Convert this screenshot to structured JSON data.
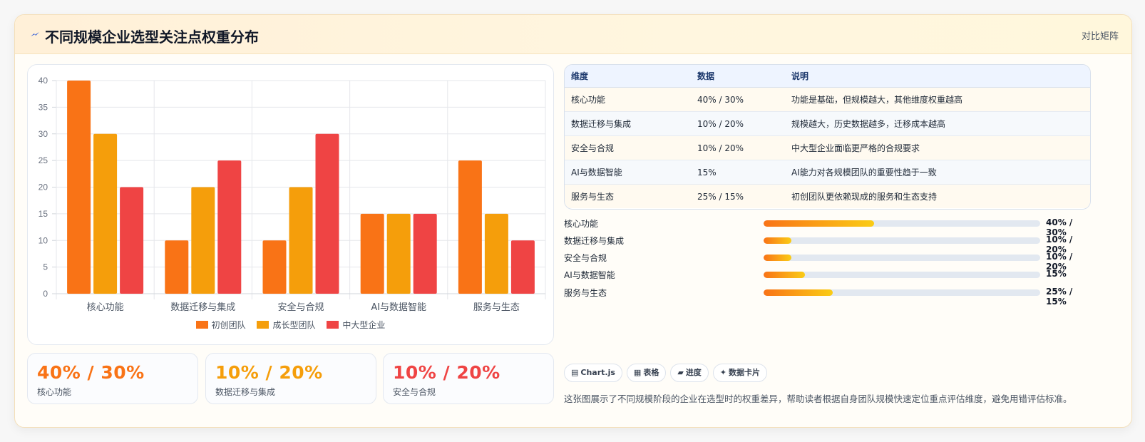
{
  "header": {
    "icon": "lightning-icon",
    "title": "不同规模企业选型关注点权重分布",
    "right_label": "对比矩阵"
  },
  "colors": {
    "series": [
      "#f97316",
      "#f59e0b",
      "#ef4444"
    ],
    "accent": "#f97316"
  },
  "chart_data": {
    "type": "bar",
    "categories": [
      "核心功能",
      "数据迁移与集成",
      "安全与合规",
      "AI与数据智能",
      "服务与生态"
    ],
    "series": [
      {
        "name": "初创团队",
        "values": [
          40,
          10,
          10,
          15,
          25
        ]
      },
      {
        "name": "成长型团队",
        "values": [
          30,
          20,
          20,
          15,
          15
        ]
      },
      {
        "name": "中大型企业",
        "values": [
          20,
          25,
          30,
          15,
          10
        ]
      }
    ],
    "yticks": [
      "0",
      "5",
      "10",
      "15",
      "20",
      "25",
      "30",
      "35",
      "40"
    ],
    "ylim": [
      0,
      40
    ],
    "grid": true,
    "legend_position": "bottom"
  },
  "stats": [
    {
      "value": "40% / 30%",
      "label": "核心功能",
      "color": "#f97316"
    },
    {
      "value": "10% / 20%",
      "label": "数据迁移与集成",
      "color": "#f59e0b"
    },
    {
      "value": "10% / 20%",
      "label": "安全与合规",
      "color": "#ef4444"
    }
  ],
  "table": {
    "headers": [
      "维度",
      "数据",
      "说明"
    ],
    "rows": [
      [
        "核心功能",
        "40% / 30%",
        "功能是基础，但规模越大，其他维度权重越高"
      ],
      [
        "数据迁移与集成",
        "10% / 20%",
        "规模越大，历史数据越多，迁移成本越高"
      ],
      [
        "安全与合规",
        "10% / 20%",
        "中大型企业面临更严格的合规要求"
      ],
      [
        "AI与数据智能",
        "15%",
        "AI能力对各规模团队的重要性趋于一致"
      ],
      [
        "服务与生态",
        "25% / 15%",
        "初创团队更依赖现成的服务和生态支持"
      ]
    ]
  },
  "progress": [
    {
      "label": "核心功能",
      "value": "40% / 30%",
      "fraction": 0.4
    },
    {
      "label": "数据迁移与集成",
      "value": "10% / 20%",
      "fraction": 0.1
    },
    {
      "label": "安全与合规",
      "value": "10% / 20%",
      "fraction": 0.1
    },
    {
      "label": "AI与数据智能",
      "value": "15%",
      "fraction": 0.15
    },
    {
      "label": "服务与生态",
      "value": "25% / 15%",
      "fraction": 0.25
    }
  ],
  "chips": [
    {
      "icon": "chart-icon",
      "glyph": "▤",
      "label": "Chart.js"
    },
    {
      "icon": "table-icon",
      "glyph": "▦",
      "label": "表格"
    },
    {
      "icon": "progress-icon",
      "glyph": "▰",
      "label": "进度"
    },
    {
      "icon": "sparkle-icon",
      "glyph": "✦",
      "label": "数据卡片"
    }
  ],
  "description": "这张图展示了不同规模阶段的企业在选型时的权重差异，帮助读者根据自身团队规模快速定位重点评估维度，避免用错评估标准。"
}
